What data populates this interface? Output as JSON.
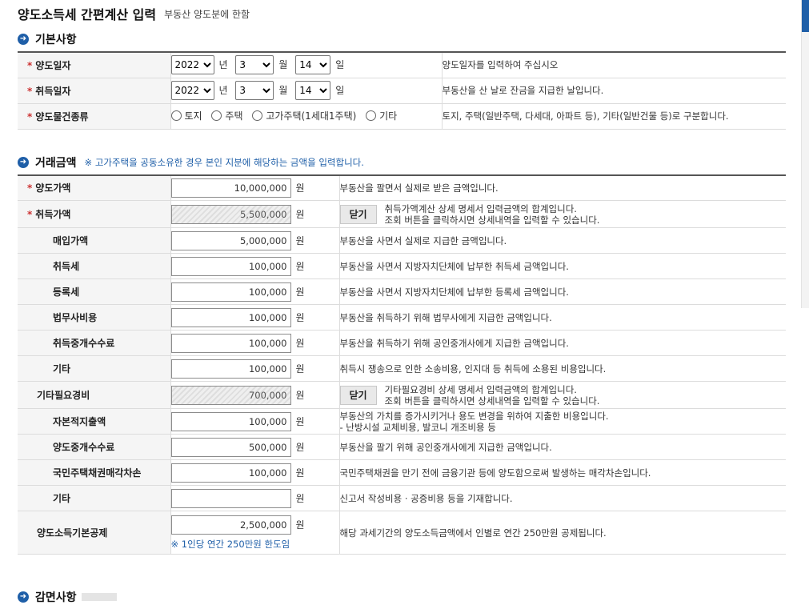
{
  "header": {
    "title": "양도소득세 간편계산 입력",
    "subtitle": "부동산 양도분에 한함"
  },
  "basic": {
    "title": "기본사항",
    "rows": [
      {
        "label": "양도일자",
        "required": true,
        "year": "2022",
        "month": "3",
        "day": "14",
        "desc": "양도일자를 입력하여 주십시오"
      },
      {
        "label": "취득일자",
        "required": true,
        "year": "2022",
        "month": "3",
        "day": "14",
        "desc": "부동산을 산 날로 잔금을 지급한 날입니다."
      }
    ],
    "units": {
      "year": "년",
      "month": "월",
      "day": "일"
    },
    "property": {
      "label": "양도물건종류",
      "options": [
        "토지",
        "주택",
        "고가주택(1세대1주택)",
        "기타"
      ],
      "desc": "토지, 주택(일반주택, 다세대, 아파트 등), 기타(일반건물 등)로 구분합니다."
    }
  },
  "trade": {
    "title": "거래금액",
    "note": "※ 고가주택을 공동소유한 경우 본인 지분에 해당하는 금액을 입력합니다.",
    "won": "원",
    "close_label": "닫기",
    "rows": {
      "sale": {
        "label": "양도가액",
        "value": "10,000,000",
        "desc": "부동산을 팔면서 실제로 받은 금액입니다."
      },
      "acq": {
        "label": "취득가액",
        "value": "5,500,000",
        "desc1": "취득가액계산 상세 명세서 입력금액의 합계입니다.",
        "desc2": "조회 버튼을 클릭하시면 상세내역을 입력할 수 있습니다."
      },
      "purchase": {
        "label": "매입가액",
        "value": "5,000,000",
        "desc": "부동산을 사면서 실제로 지급한 금액입니다."
      },
      "acqtax": {
        "label": "취득세",
        "value": "100,000",
        "desc": "부동산을 사면서 지방자치단체에 납부한 취득세 금액입니다."
      },
      "regtax": {
        "label": "등록세",
        "value": "100,000",
        "desc": "부동산을 사면서 지방자치단체에 납부한 등록세 금액입니다."
      },
      "legal": {
        "label": "법무사비용",
        "value": "100,000",
        "desc": "부동산을 취득하기 위해 법무사에게 지급한 금액입니다."
      },
      "acqbroker": {
        "label": "취득중개수수료",
        "value": "100,000",
        "desc": "부동산을 취득하기 위해 공인중개사에게 지급한 금액입니다."
      },
      "acqetc": {
        "label": "기타",
        "value": "100,000",
        "desc": "취득시 쟁송으로 인한 소송비용, 인지대 등 취득에 소용된 비용입니다."
      },
      "otherexp": {
        "label": "기타필요경비",
        "value": "700,000",
        "desc1": "기타필요경비 상세 명세서 입력금액의 합계입니다.",
        "desc2": "조회 버튼을 클릭하시면 상세내역을 입력할 수 있습니다."
      },
      "capex": {
        "label": "자본적지출액",
        "value": "100,000",
        "desc1": "부동산의 가치를 증가시키거나 용도 변경을 위하여 지출한 비용입니다.",
        "desc2": "- 난방시설 교체비용, 발코니 개조비용 등"
      },
      "salebroker": {
        "label": "양도중개수수료",
        "value": "500,000",
        "desc": "부동산을 팔기 위해 공인중개사에게 지급한 금액입니다."
      },
      "bondloss": {
        "label": "국민주택채권매각차손",
        "value": "100,000",
        "desc": "국민주택채권을 만기 전에 금융기관 등에 양도함으로써 발생하는 매각차손입니다."
      },
      "saleetc": {
        "label": "기타",
        "value": "",
        "desc": "신고서 작성비용 · 공증비용 등을 기재합니다."
      },
      "deduct": {
        "label": "양도소득기본공제",
        "value": "2,500,000",
        "note": "※ 1인당 연간 250만원 한도임",
        "desc": "해당 과세기간의 양도소득금액에서 인별로 연간 250만원 공제됩니다."
      }
    }
  },
  "next_section": {
    "title": "감면사항"
  },
  "colors": {
    "accent": "#1f5fa8",
    "required": "#c33333"
  }
}
